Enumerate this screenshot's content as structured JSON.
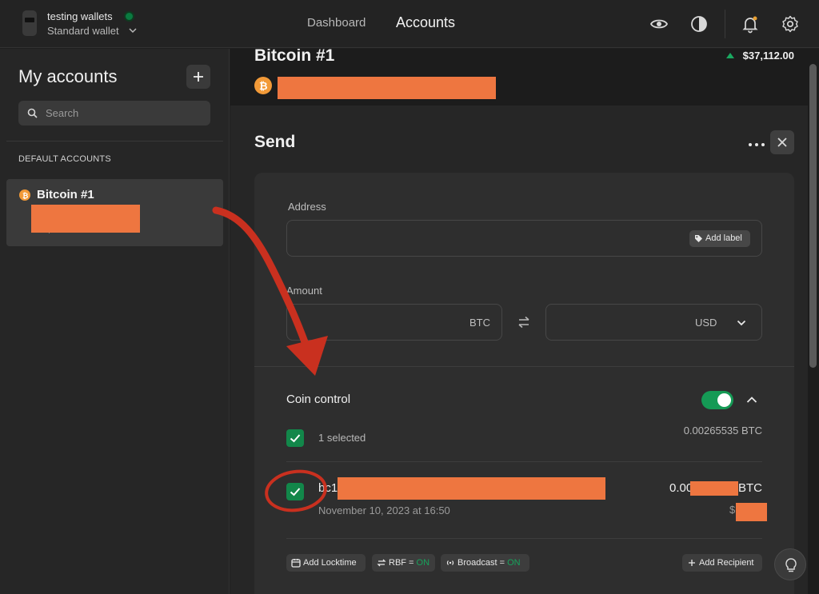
{
  "topbar": {
    "wallet_name": "testing wallets",
    "wallet_type": "Standard wallet",
    "nav_dashboard": "Dashboard",
    "nav_accounts": "Accounts",
    "status_color": "#0a7a40"
  },
  "sidebar": {
    "title": "My accounts",
    "add_label": "+",
    "search_placeholder": "Search",
    "section_label": "DEFAULT ACCOUNTS",
    "accounts": [
      {
        "name": "Bitcoin #1",
        "balance": "$",
        "coin_icon": "bitcoin-icon"
      }
    ]
  },
  "account_header": {
    "title": "Bitcoin #1",
    "price": "$37,112.00",
    "price_trend": "up"
  },
  "send": {
    "title": "Send",
    "address_label": "Address",
    "address_value": "",
    "add_label_button": "Add label",
    "amount_label": "Amount",
    "amount_unit": "BTC",
    "fiat_unit": "USD",
    "coin_control_title": "Coin control",
    "coin_control_enabled": true,
    "selected_count": "1 selected",
    "selected_total": "0.00265535 BTC",
    "utxo": {
      "address_prefix": "bc1",
      "amount_prefix": "0.00",
      "amount_unit": "BTC",
      "fiat_prefix": "$",
      "date": "November 10, 2023 at 16:50",
      "checked": true
    },
    "actions": {
      "locktime": "Add Locktime",
      "rbf_label": "RBF = ",
      "rbf_value": "ON",
      "broadcast_label": "Broadcast = ",
      "broadcast_value": "ON",
      "add_recipient": "Add Recipient"
    }
  },
  "colors": {
    "accent_green": "#12874a",
    "redaction": "#ee7640",
    "bitcoin": "#f29a38",
    "annotation_red": "#c9301f"
  }
}
